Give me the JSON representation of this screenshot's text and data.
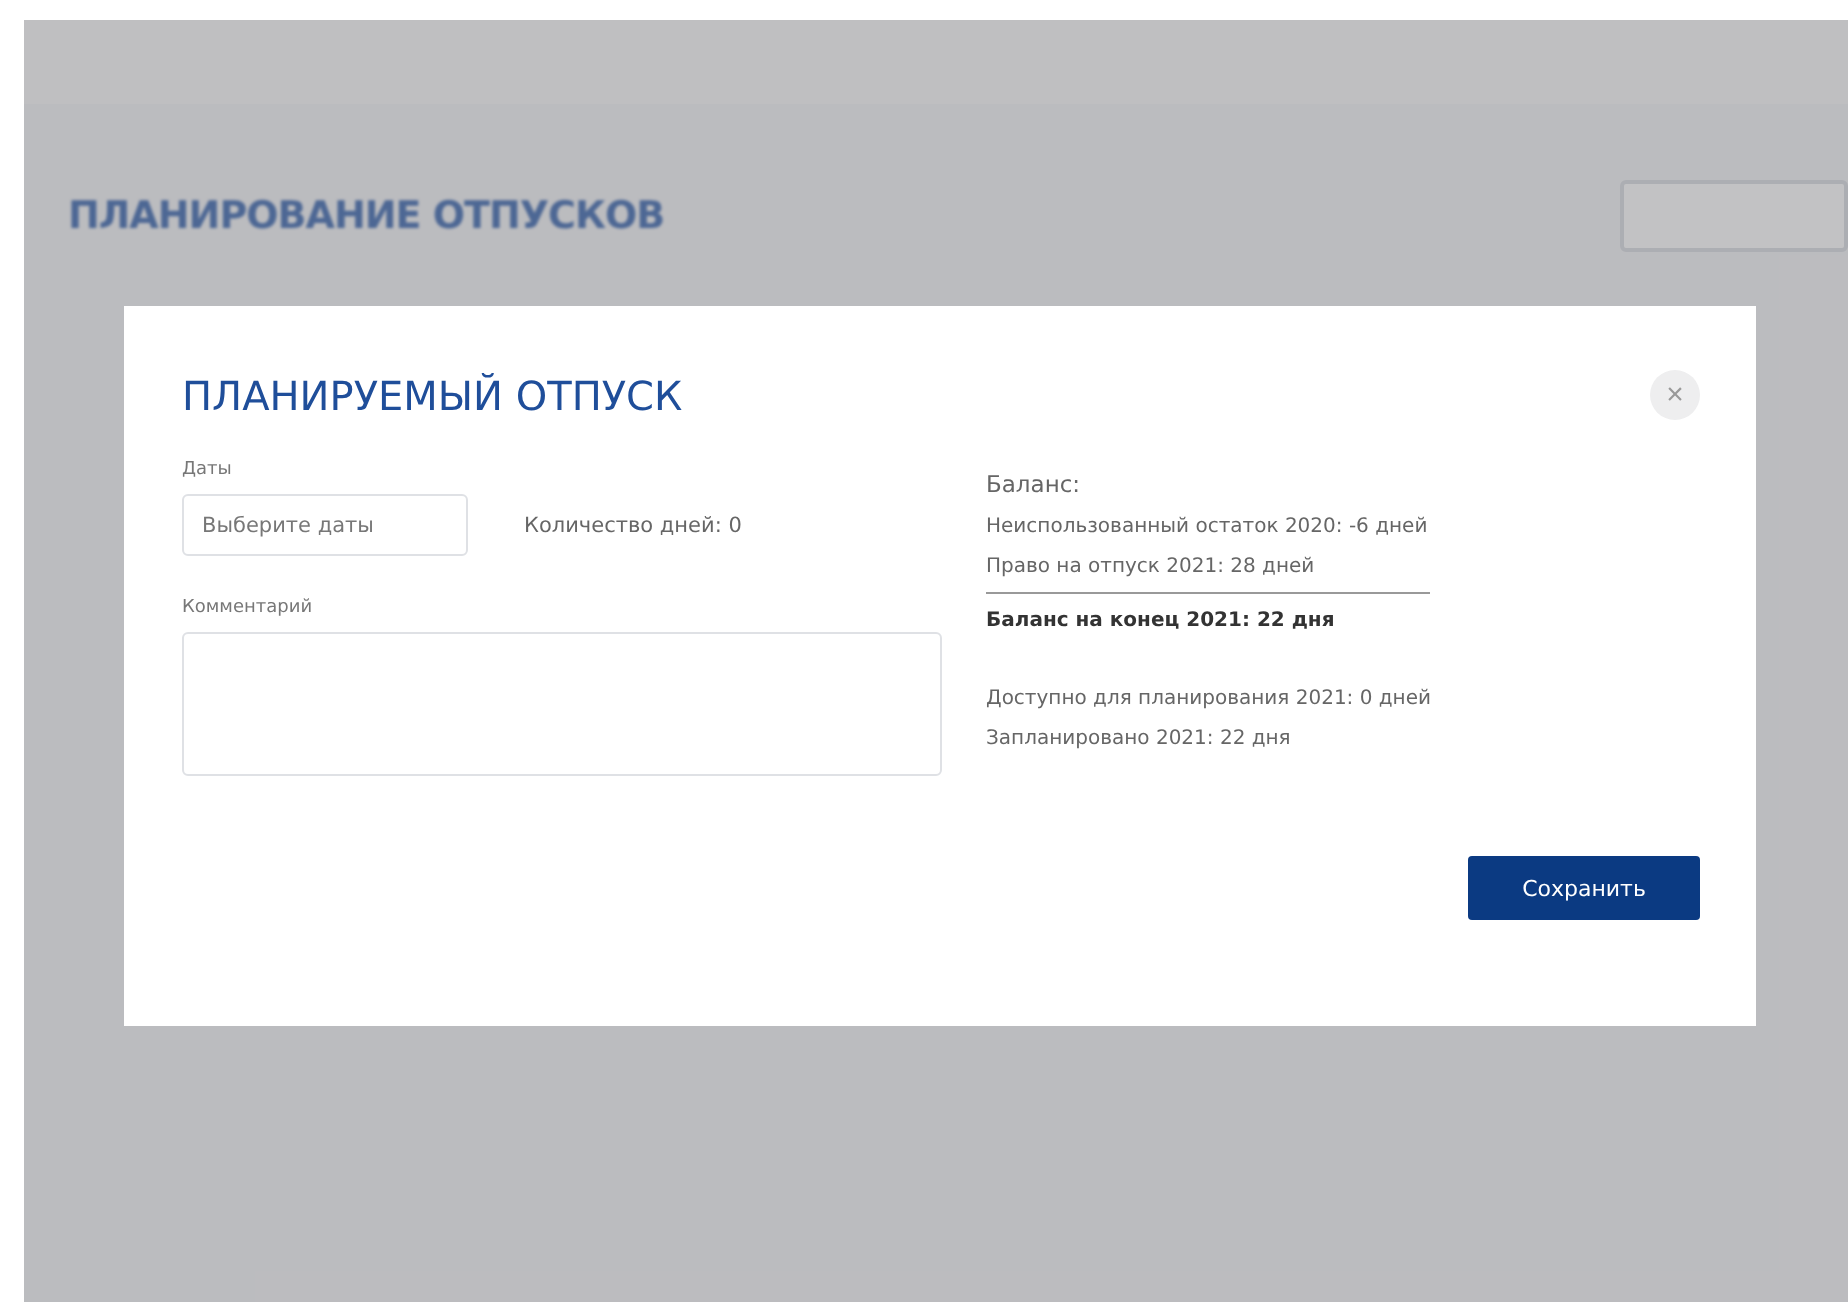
{
  "page": {
    "title": "ПЛАНИРОВАНИЕ ОТПУСКОВ"
  },
  "modal": {
    "title": "ПЛАНИРУЕМЫЙ ОТПУСК",
    "close": "×",
    "dates": {
      "label": "Даты",
      "placeholder": "Выберите даты"
    },
    "days_count": "Количество дней: 0",
    "comment": {
      "label": "Комментарий"
    },
    "balance": {
      "title": "Баланс:",
      "lines": [
        "Неиспользованный остаток 2020: -6 дней",
        "Право на отпуск 2021: 28 дней"
      ],
      "total": "Баланс на конец 2021: 22 дня",
      "planning": [
        "Доступно для планирования 2021: 0 дней",
        "Запланировано 2021: 22 дня"
      ]
    },
    "save_button": "Сохранить"
  }
}
